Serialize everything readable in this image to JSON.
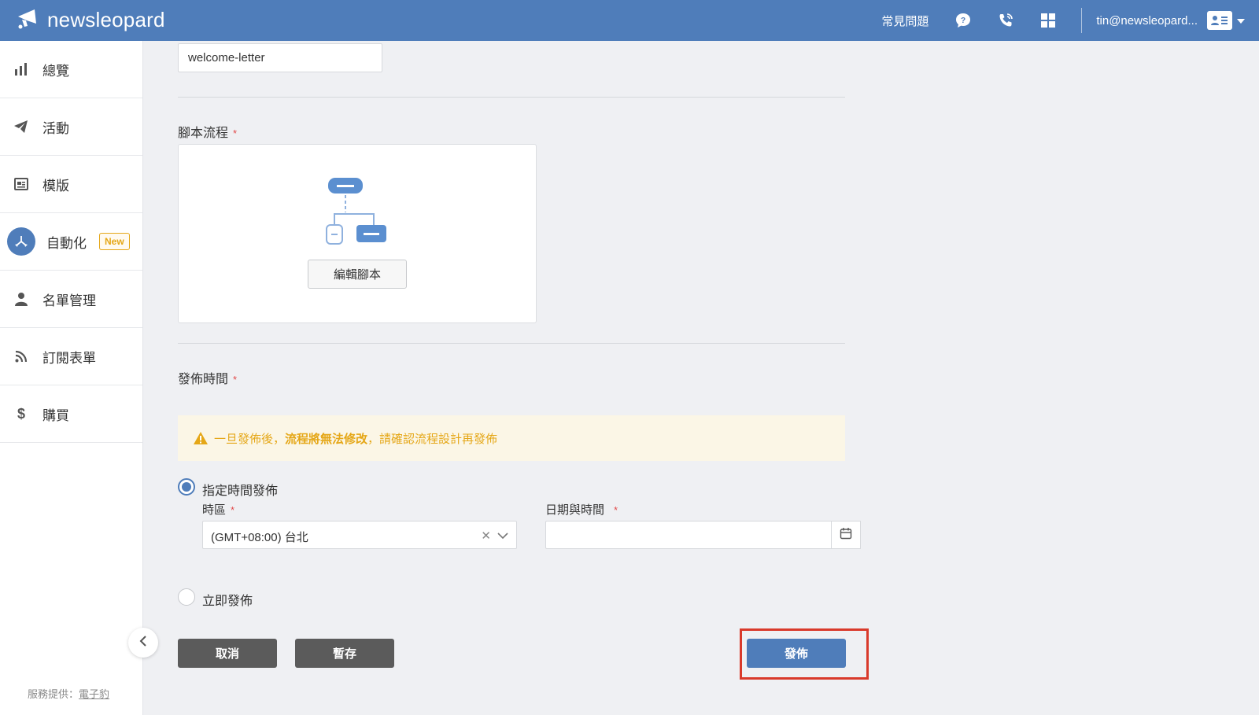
{
  "header": {
    "brand": "newsleopard",
    "faq_label": "常見問題",
    "user_email": "tin@newsleopard..."
  },
  "sidebar": {
    "items": [
      {
        "label": "總覽",
        "icon": "bar-chart-icon"
      },
      {
        "label": "活動",
        "icon": "paper-plane-icon"
      },
      {
        "label": "模版",
        "icon": "template-icon"
      },
      {
        "label": "自動化",
        "icon": "automation-icon",
        "active": true,
        "badge": "New"
      },
      {
        "label": "名單管理",
        "icon": "person-icon"
      },
      {
        "label": "訂閱表單",
        "icon": "rss-icon"
      },
      {
        "label": "購買",
        "icon": "dollar-icon"
      }
    ],
    "powered_prefix": "服務提供：",
    "powered_link": "電子豹"
  },
  "form": {
    "name_value": "welcome-letter",
    "script_flow_label": "腳本流程",
    "edit_script_button": "編輯腳本",
    "publish_time_label": "發佈時間",
    "warning_prefix": "一旦發佈後，",
    "warning_bold": "流程將無法修改",
    "warning_suffix": "，請確認流程設計再發佈",
    "option_scheduled": "指定時間發佈",
    "timezone_label": "時區",
    "timezone_value": "(GMT+08:00) 台北",
    "datetime_label": "日期與時間",
    "datetime_value": "",
    "option_immediate": "立即發佈",
    "required_mark": "*"
  },
  "actions": {
    "cancel": "取消",
    "save_draft": "暫存",
    "publish": "發佈"
  },
  "colors": {
    "primary": "#4f7dba",
    "warning": "#e5a717",
    "highlight": "#d93a2b"
  }
}
